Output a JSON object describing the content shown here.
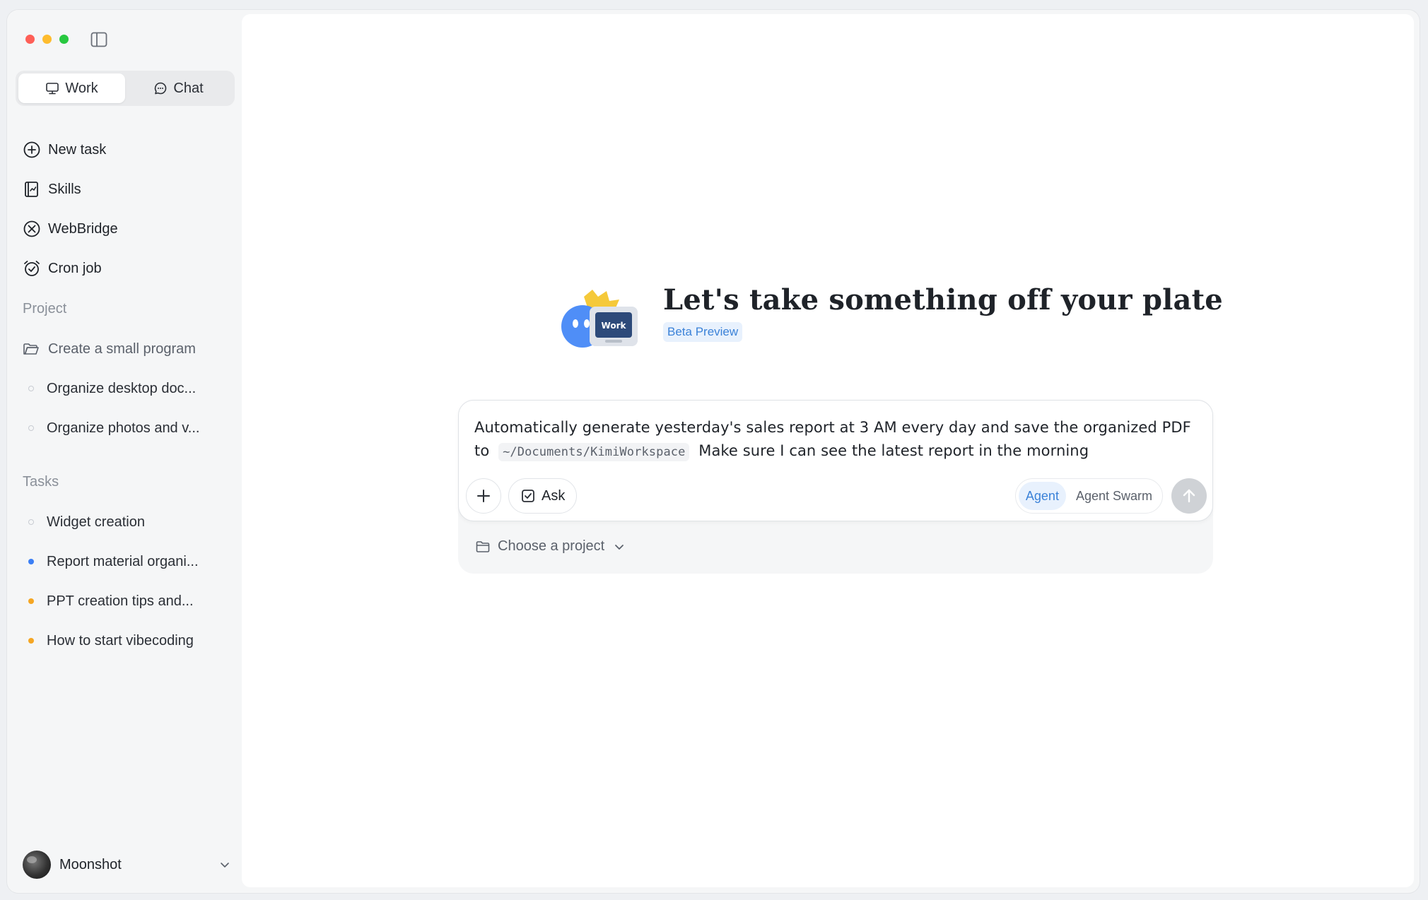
{
  "sidebar": {
    "mode_tabs": [
      {
        "label": "Work",
        "icon": "monitor-icon",
        "active": true
      },
      {
        "label": "Chat",
        "icon": "chat-bubble-icon",
        "active": false
      }
    ],
    "nav": [
      {
        "label": "New task",
        "icon": "plus-circle-icon"
      },
      {
        "label": "Skills",
        "icon": "skills-book-icon"
      },
      {
        "label": "WebBridge",
        "icon": "webbridge-icon"
      },
      {
        "label": "Cron job",
        "icon": "alarm-clock-icon"
      }
    ],
    "project_section": {
      "label": "Project",
      "root": "Create a small program",
      "items": [
        "Organize desktop doc...",
        "Organize photos and v..."
      ]
    },
    "tasks_section": {
      "label": "Tasks",
      "items": [
        {
          "label": "Widget creation",
          "status": "empty"
        },
        {
          "label": "Report material organi...",
          "status": "blue"
        },
        {
          "label": "PPT creation tips and...",
          "status": "orange"
        },
        {
          "label": "How to start vibecoding",
          "status": "orange"
        }
      ]
    },
    "user": {
      "name": "Moonshot"
    }
  },
  "main": {
    "hero": {
      "title": "Let's take something off your plate",
      "badge": "Beta Preview",
      "mascot_label": "Work"
    },
    "composer": {
      "prompt_before": "Automatically generate yesterday's sales report at 3 AM every day and save the organized PDF to",
      "path": "~/Documents/KimiWorkspace",
      "prompt_after": "Make sure I can see the latest report in the morning",
      "ask_label": "Ask",
      "agent_options": [
        "Agent",
        "Agent Swarm"
      ],
      "active_agent": "Agent",
      "project_picker": "Choose a project"
    }
  },
  "colors": {
    "accent": "#3b82d8",
    "accent_bg": "#e8f1fd",
    "status_blue": "#3b7ff5",
    "status_orange": "#f5a623"
  }
}
